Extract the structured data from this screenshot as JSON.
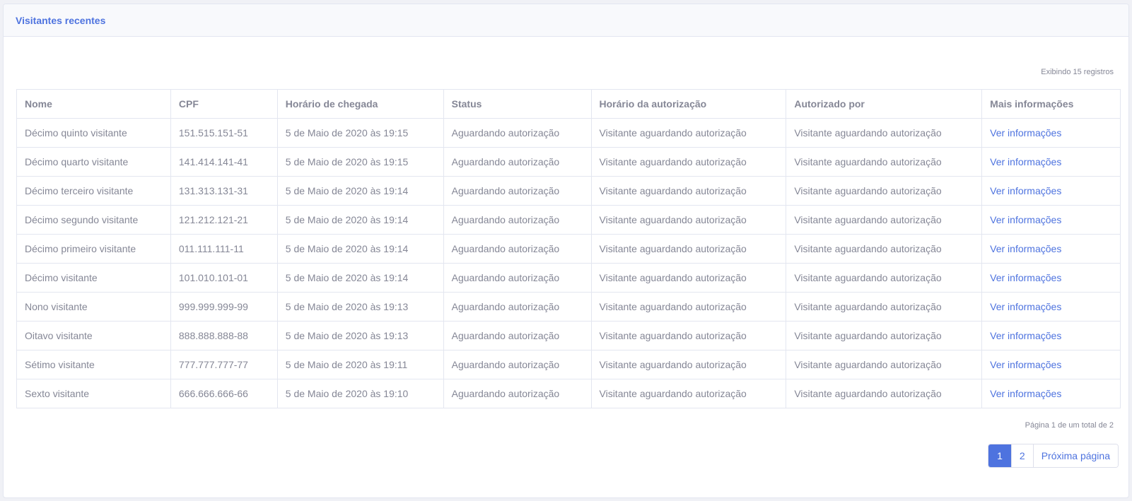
{
  "card": {
    "title": "Visitantes recentes",
    "records_info": "Exibindo 15 registros"
  },
  "table": {
    "headers": [
      "Nome",
      "CPF",
      "Horário de chegada",
      "Status",
      "Horário da autorização",
      "Autorizado por",
      "Mais informações"
    ],
    "rows": [
      [
        "Décimo quinto visitante",
        "151.515.151-51",
        "5 de Maio de 2020 às 19:15",
        "Aguardando autorização",
        "Visitante aguardando autorização",
        "Visitante aguardando autorização",
        "Ver informações"
      ],
      [
        "Décimo quarto visitante",
        "141.414.141-41",
        "5 de Maio de 2020 às 19:15",
        "Aguardando autorização",
        "Visitante aguardando autorização",
        "Visitante aguardando autorização",
        "Ver informações"
      ],
      [
        "Décimo terceiro visitante",
        "131.313.131-31",
        "5 de Maio de 2020 às 19:14",
        "Aguardando autorização",
        "Visitante aguardando autorização",
        "Visitante aguardando autorização",
        "Ver informações"
      ],
      [
        "Décimo segundo visitante",
        "121.212.121-21",
        "5 de Maio de 2020 às 19:14",
        "Aguardando autorização",
        "Visitante aguardando autorização",
        "Visitante aguardando autorização",
        "Ver informações"
      ],
      [
        "Décimo primeiro visitante",
        "011.111.111-11",
        "5 de Maio de 2020 às 19:14",
        "Aguardando autorização",
        "Visitante aguardando autorização",
        "Visitante aguardando autorização",
        "Ver informações"
      ],
      [
        "Décimo visitante",
        "101.010.101-01",
        "5 de Maio de 2020 às 19:14",
        "Aguardando autorização",
        "Visitante aguardando autorização",
        "Visitante aguardando autorização",
        "Ver informações"
      ],
      [
        "Nono visitante",
        "999.999.999-99",
        "5 de Maio de 2020 às 19:13",
        "Aguardando autorização",
        "Visitante aguardando autorização",
        "Visitante aguardando autorização",
        "Ver informações"
      ],
      [
        "Oitavo visitante",
        "888.888.888-88",
        "5 de Maio de 2020 às 19:13",
        "Aguardando autorização",
        "Visitante aguardando autorização",
        "Visitante aguardando autorização",
        "Ver informações"
      ],
      [
        "Sétimo visitante",
        "777.777.777-77",
        "5 de Maio de 2020 às 19:11",
        "Aguardando autorização",
        "Visitante aguardando autorização",
        "Visitante aguardando autorização",
        "Ver informações"
      ],
      [
        "Sexto visitante",
        "666.666.666-66",
        "5 de Maio de 2020 às 19:10",
        "Aguardando autorização",
        "Visitante aguardando autorização",
        "Visitante aguardando autorização",
        "Ver informações"
      ]
    ]
  },
  "pagination": {
    "info": "Página 1 de um total de 2",
    "pages": [
      "1",
      "2"
    ],
    "active_page": "1",
    "next_label": "Próxima página"
  },
  "colors": {
    "accent": "#4e73df",
    "text_muted": "#858796",
    "border": "#e3e6f0"
  }
}
